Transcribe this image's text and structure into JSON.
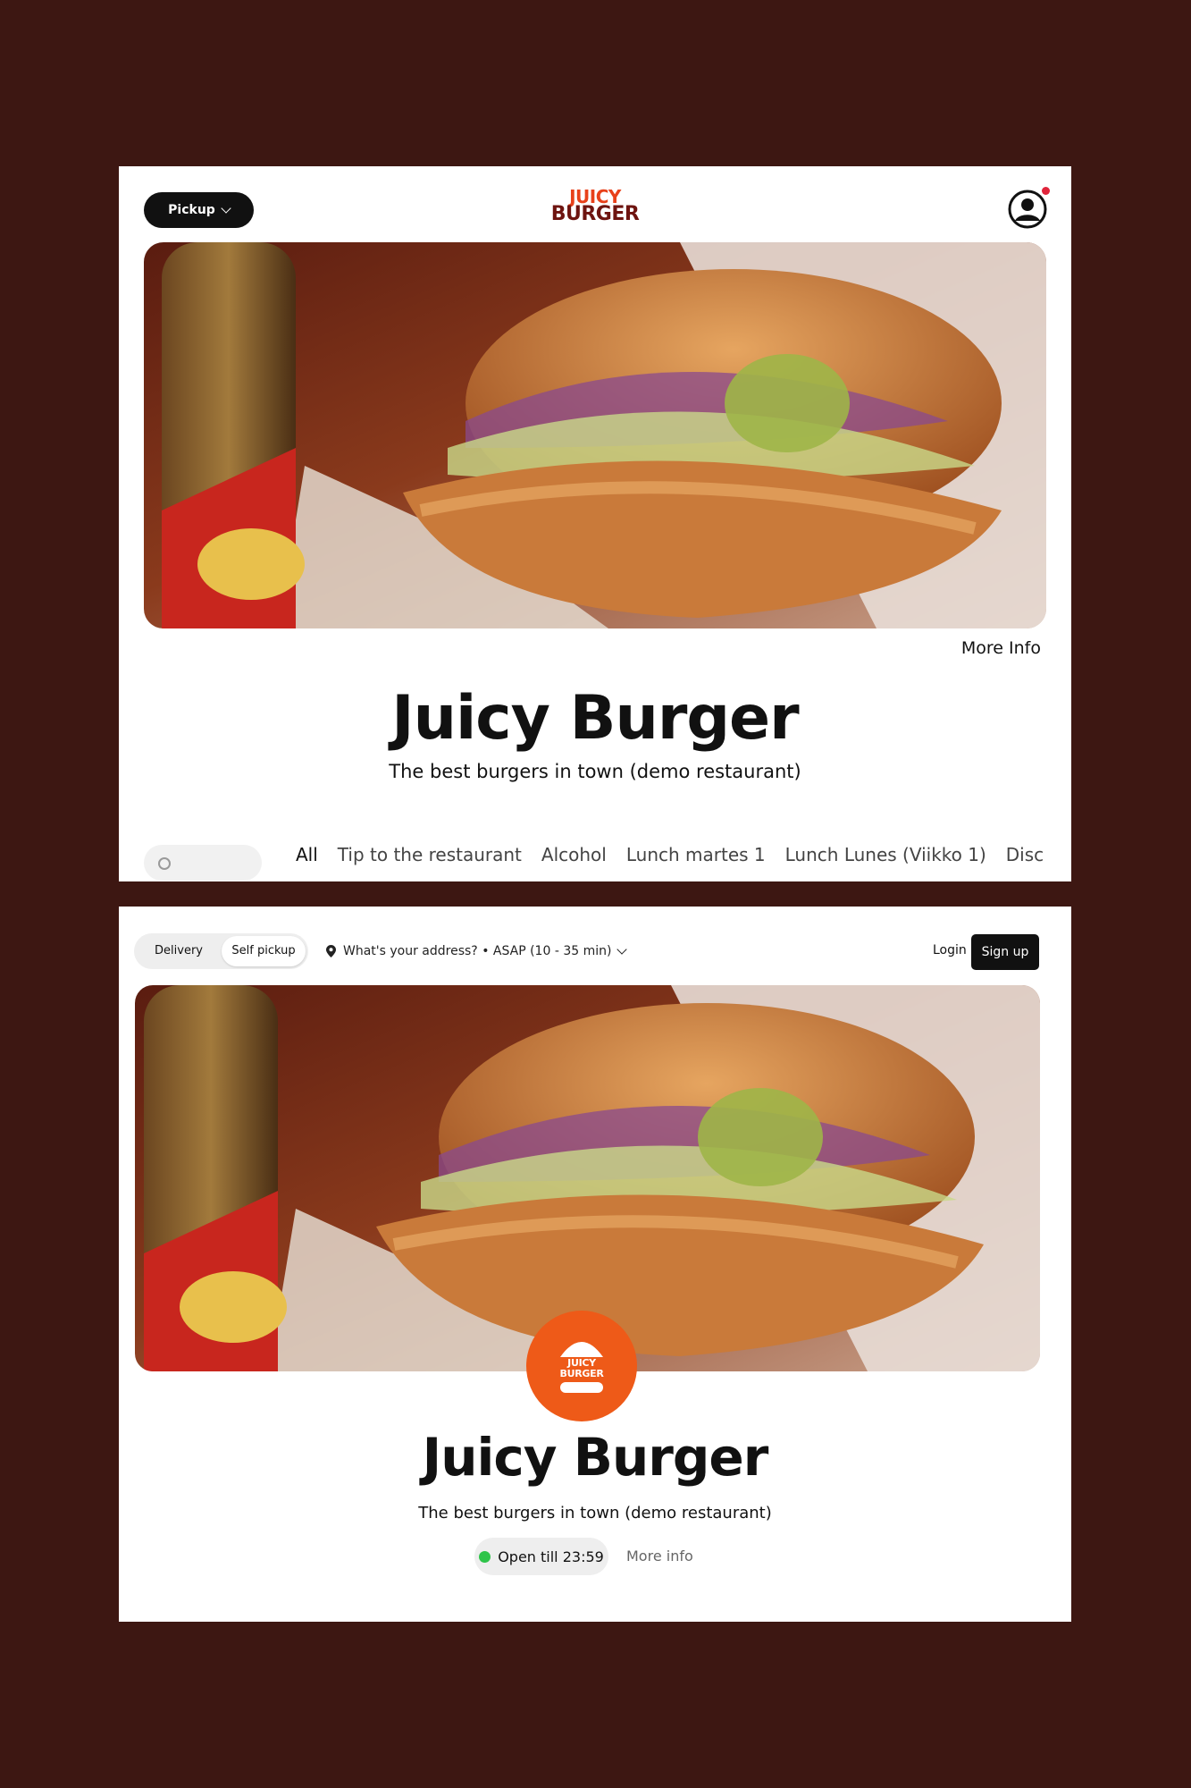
{
  "top_view": {
    "mode_button_label": "Pickup",
    "logo_line1": "JUICY",
    "logo_line2": "BURGER",
    "more_info_label": "More Info",
    "restaurant_name": "Juicy Burger",
    "tagline": "The best burgers in town (demo restaurant)",
    "categories": [
      "All",
      "Tip to the restaurant",
      "Alcohol",
      "Lunch martes 1",
      "Lunch Lunes (Viikko 1)",
      "Disc"
    ]
  },
  "bottom_view": {
    "delivery_label": "Delivery",
    "self_pickup_label": "Self pickup",
    "address_text": "What's your address? • ASAP (10 - 35 min)",
    "login_label": "Login",
    "signup_label": "Sign up",
    "badge_line1": "JUICY",
    "badge_line2": "BURGER",
    "restaurant_name": "Juicy Burger",
    "tagline": "The best burgers in town (demo restaurant)",
    "status_text": "Open till 23:59",
    "more_info_label": "More info"
  },
  "colors": {
    "page_background": "#3d1712",
    "brand_orange": "#ee5a18",
    "logo_dark_red": "#6e1410",
    "open_status_green": "#2ec44a",
    "notification_red": "#e0243b"
  },
  "icons": {
    "account": "user-circle-icon",
    "dropdown": "chevron-down-icon",
    "location": "map-pin-icon",
    "search": "search-icon"
  }
}
